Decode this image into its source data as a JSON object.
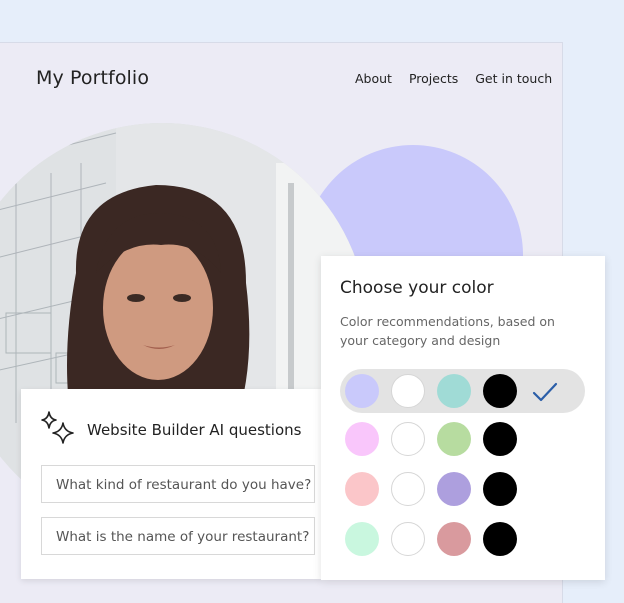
{
  "portfolio": {
    "brand": "My Portfolio",
    "nav": [
      "About",
      "Projects",
      "Get in touch"
    ]
  },
  "ai_card": {
    "title": "Website Builder AI questions",
    "questions": [
      "What kind of restaurant do you have?",
      "What is the name of your restaurant?"
    ]
  },
  "color_card": {
    "title": "Choose your color",
    "subtitle": "Color recommendations, based on your category and design",
    "palettes": [
      {
        "colors": [
          "#c9c9fb",
          "#ffffff",
          "#a0dbd6",
          "#000000"
        ],
        "selected": true
      },
      {
        "colors": [
          "#f9c6fb",
          "#ffffff",
          "#b7dca0",
          "#000000"
        ],
        "selected": false
      },
      {
        "colors": [
          "#fbc6c9",
          "#ffffff",
          "#ad9fde",
          "#000000"
        ],
        "selected": false
      },
      {
        "colors": [
          "#c9f7df",
          "#ffffff",
          "#d99a9e",
          "#000000"
        ],
        "selected": false
      }
    ]
  },
  "icons": {
    "sparkle": "sparkle-icon",
    "check": "check-icon"
  }
}
